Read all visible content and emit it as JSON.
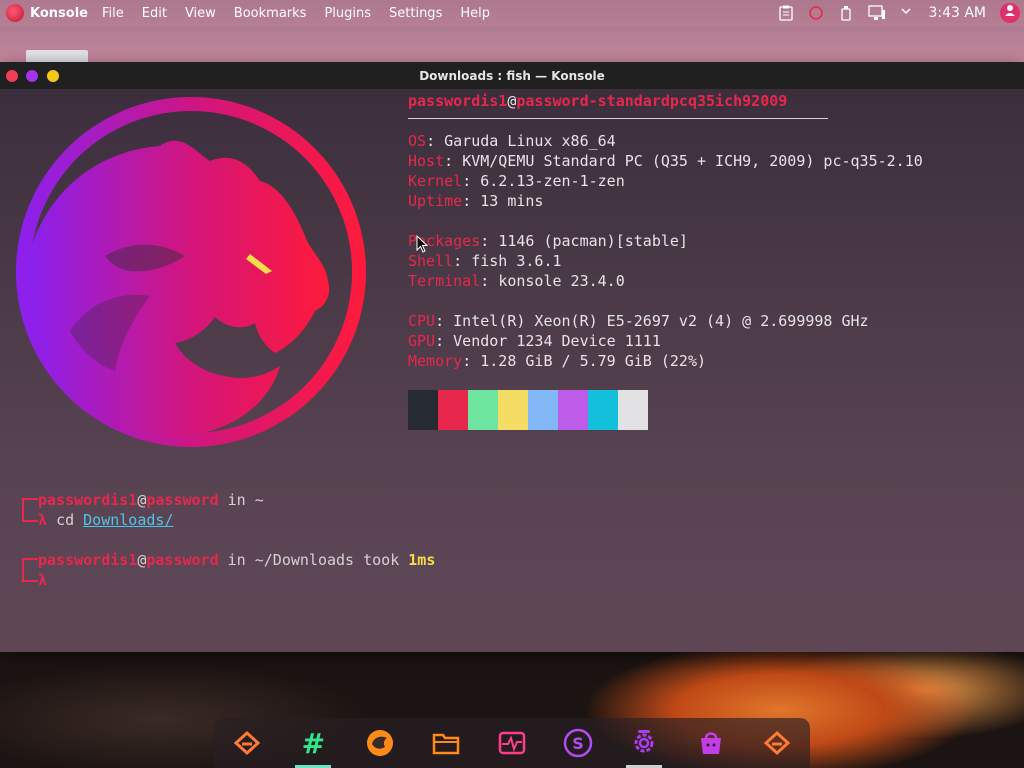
{
  "menubar": {
    "app_name": "Konsole",
    "menus": [
      "File",
      "Edit",
      "View",
      "Bookmarks",
      "Plugins",
      "Settings",
      "Help"
    ],
    "clock": "3:43 AM",
    "tray_icons": [
      "clipboard-icon",
      "notification-icon",
      "usb-icon",
      "network-icon",
      "chevron-down-icon"
    ]
  },
  "window": {
    "title": "Downloads : fish — Konsole",
    "controls": {
      "close_color": "#f23d56",
      "minimize_color": "#a233e8",
      "maximize_color": "#f5c91a"
    }
  },
  "fetch": {
    "user_host": {
      "user": "passwordis1",
      "at": "@",
      "host": "password-standardpcq35ich92009"
    },
    "info": [
      {
        "key": "OS",
        "value": "Garuda Linux x86_64"
      },
      {
        "key": "Host",
        "value": "KVM/QEMU Standard PC (Q35 + ICH9, 2009) pc-q35-2.10"
      },
      {
        "key": "Kernel",
        "value": "6.2.13-zen-1-zen"
      },
      {
        "key": "Uptime",
        "value": "13 mins"
      },
      {
        "key": "Packages",
        "value": "1146 (pacman)[stable]"
      },
      {
        "key": "Shell",
        "value": "fish 3.6.1"
      },
      {
        "key": "Terminal",
        "value": "konsole 23.4.0"
      },
      {
        "key": "CPU",
        "value": "Intel(R) Xeon(R) E5-2697 v2 (4) @ 2.699998 GHz"
      },
      {
        "key": "GPU",
        "value": "Vendor 1234 Device 1111"
      },
      {
        "key": "Memory",
        "value": "1.28 GiB / 5.79 GiB (22%)"
      }
    ],
    "sep": ": ",
    "palette": [
      "#262a31",
      "#e8274d",
      "#6ee6a0",
      "#f5dd65",
      "#82b8f5",
      "#bd5ce8",
      "#12c0dc",
      "#e2e2e4"
    ]
  },
  "prompts": [
    {
      "user": "passwordis1",
      "at": "@",
      "host": "password",
      "in": " in ",
      "dir": "~",
      "lambda": "λ",
      "command": "cd ",
      "arg": "Downloads/"
    },
    {
      "user": "passwordis1",
      "at": "@",
      "host": "password",
      "in": " in ",
      "dir": "~/Downloads",
      "took": " took ",
      "duration": "1ms",
      "lambda": "λ"
    }
  ],
  "dock": {
    "items": [
      {
        "name": "garuda-welcome-icon",
        "color": "#ff7a35"
      },
      {
        "name": "hashtag-app-icon",
        "color": "#2fe88a"
      },
      {
        "name": "garuda-dragon-icon",
        "color": "#ff8a1a"
      },
      {
        "name": "folder-icon",
        "color": "#ff8a1a"
      },
      {
        "name": "system-monitor-icon",
        "color": "#ff3d8a"
      },
      {
        "name": "software-store-icon",
        "color": "#b04cf0"
      },
      {
        "name": "settings-gear-icon",
        "color": "#a93ef0"
      },
      {
        "name": "shopping-bag-icon",
        "color": "#c23ce8"
      },
      {
        "name": "garuda-assistant-icon",
        "color": "#ff7a35"
      }
    ]
  }
}
